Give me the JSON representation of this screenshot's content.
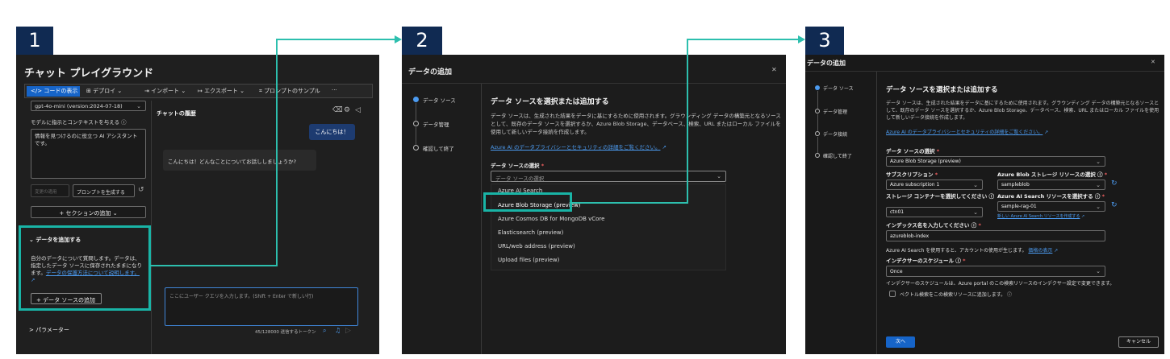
{
  "badges": [
    "1",
    "2",
    "3"
  ],
  "panel1": {
    "title": "チャット プレイグラウンド",
    "toolbar": {
      "view_code": "</> コードの表示",
      "deploy": "⊞ デプロイ ⌄",
      "import": "⇥ インポート ⌄",
      "export": "↦ エクスポート ⌄",
      "prompt_samples": "⌗ プロンプトのサンプル",
      "more": "···"
    },
    "model_select": "gpt-4o-mini (version:2024-07-18)",
    "instruction_label": "モデルに指示とコンテキストを与える ⓘ",
    "system_message": "情報を見つけるのに役立つ AI アシスタントです。",
    "apply_changes": "変更の適用",
    "generate_prompt": "プロンプトを生成する",
    "add_section": "+ セクションの追加 ⌄",
    "add_data_header": "⌄ データを追加する",
    "add_data_desc": "自分のデータについて質問します。データは、指定したデータ ソースに保存されたままになります。",
    "data_protection_link": "データの保護方法について説明します。",
    "add_data_source_btn": "+ データ ソースの追加",
    "parameters": "> パラメーター",
    "chat_history": "チャットの履歴",
    "user_bubble": "こんにちは！",
    "assistant_reply": "こんにちは！どんなことについてお話ししましょうか?",
    "chat_input_placeholder": "ここにユーザー クエリを入力します。(Shift + Enter で新しい行)",
    "token_count": "45/128000 送信するトークン"
  },
  "panel2": {
    "header": "データの追加",
    "steps": [
      "データ ソース",
      "データ管理",
      "確認して終了"
    ],
    "main_title": "データ ソースを選択または追加する",
    "desc": "データ ソースは、生成された結果をデータに基にするために使用されます。グラウンディング データの構築元となるソースとして、既存のデータ ソースを選択するか、Azure Blob Storage、データベース、検索、URL またはローカル ファイルを使用して新しいデータ接続を作成します。",
    "privacy_link": "Azure AI のデータプライバシーとセキュリティの詳細をご覧ください。",
    "select_label": "データ ソースの選択",
    "select_placeholder": "データ ソースの選択",
    "options": [
      "Azure AI Search",
      "Azure Blob Storage (preview)",
      "Azure Cosmos DB for MongoDB vCore",
      "Elasticsearch (preview)",
      "URL/web address (preview)",
      "Upload files (preview)"
    ],
    "close": "✕"
  },
  "panel3": {
    "header": "データの追加",
    "steps": [
      "データ ソース",
      "データ管理",
      "データ接続",
      "確認して終了"
    ],
    "main_title": "データ ソースを選択または追加する",
    "desc": "データ ソースは、生成された結果をデータに基にするために使用されます。グラウンディング データの構築元となるソースとして、既存のデータ ソースを選択するか、Azure Blob Storage、データベース、検索、URL またはローカル ファイルを使用して新しいデータ接続を作成します。",
    "privacy_link": "Azure AI のデータプライバシーとセキュリティの詳細をご覧ください。",
    "source_label": "データ ソースの選択",
    "source_value": "Azure Blob Storage (preview)",
    "subscription_label": "サブスクリプション",
    "subscription_value": "Azure subscription 1",
    "blob_label": "Azure Blob ストレージ リソースの選択",
    "blob_value": "sampleblob",
    "container_label": "ストレージ コンテナーを選択してください",
    "container_value": "ctn01",
    "search_label": "Azure AI Search リソースを選択する",
    "search_value": "sample-rag-01",
    "search_new_link": "新しい Azure AI Search リソースを作成する",
    "index_label": "インデックス名を入力してください",
    "index_value": "azureblob-index",
    "cost_note": "Azure AI Search を使用すると、アカウントの使用が生じます。",
    "pricing_link": "価格の表示",
    "schedule_label": "インデクサーのスケジュール",
    "schedule_value": "Once",
    "schedule_note": "インデクサーのスケジュールは、Azure portal のこの検索リソースのインデクサー設定で変更できます。",
    "vector_checkbox": "ベクトル検索をこの検索リソースに追加します。",
    "next_btn": "次へ",
    "cancel_btn": "キャンセル",
    "close": "✕"
  },
  "colors": {
    "accent": "#19b4a6",
    "badge": "#102a52",
    "primary": "#1664c8"
  }
}
